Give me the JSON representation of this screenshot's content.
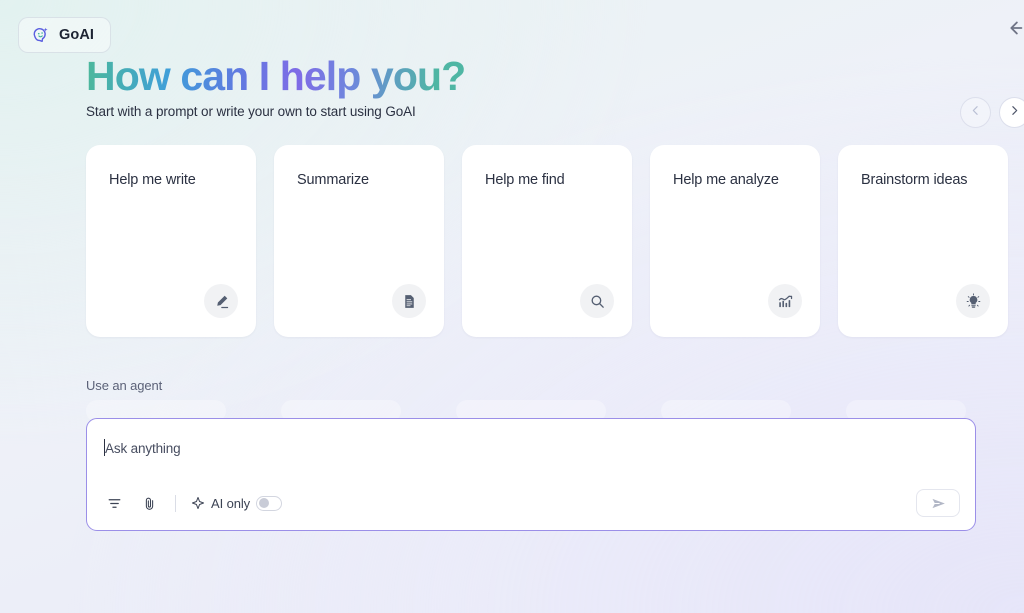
{
  "brand": {
    "name": "GoAI",
    "logo_icon": "chat-bubble-sparkle-icon"
  },
  "header": {
    "collapse_icon": "arrow-left-collapse-icon",
    "headline": "How can I help you?",
    "subhead": "Start with a prompt or write your own to start using GoAI",
    "gradient_colors": [
      "#4cb89b",
      "#3f9fd9",
      "#5f7ae0",
      "#7f6ce6",
      "#4fb6a4"
    ]
  },
  "carousel": {
    "prev_icon": "chevron-left-icon",
    "next_icon": "chevron-right-icon",
    "prev_enabled": false,
    "next_enabled": true
  },
  "cards": [
    {
      "title": "Help me write",
      "icon": "pencil-icon"
    },
    {
      "title": "Summarize",
      "icon": "document-icon"
    },
    {
      "title": "Help me find",
      "icon": "search-icon"
    },
    {
      "title": "Help me analyze",
      "icon": "bar-chart-trend-icon"
    },
    {
      "title": "Brainstorm ideas",
      "icon": "lightbulb-icon"
    }
  ],
  "agent": {
    "label": "Use an agent"
  },
  "composer": {
    "placeholder": "Ask anything",
    "value": "",
    "toolbar": {
      "filter_icon": "filter-sliders-icon",
      "attach_icon": "paperclip-icon",
      "ai_only_icon": "sparkle-icon",
      "ai_only_label": "AI only",
      "ai_only_enabled": false,
      "send_icon": "send-paper-plane-icon"
    },
    "border_color": "#9b8fe8"
  }
}
